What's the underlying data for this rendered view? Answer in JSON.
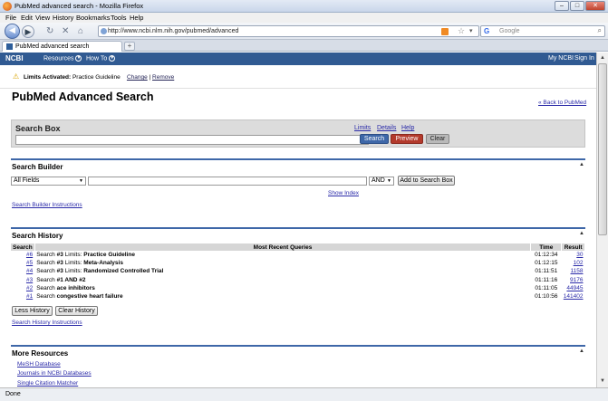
{
  "window": {
    "title": "PubMed advanced search - Mozilla Firefox"
  },
  "menu": [
    "File",
    "Edit",
    "View",
    "History",
    "Bookmarks",
    "Tools",
    "Help"
  ],
  "address": {
    "url": "http://www.ncbi.nlm.nih.gov/pubmed/advanced"
  },
  "search_engine": {
    "placeholder": "Google",
    "brand": "G"
  },
  "tab": {
    "label": "PubMed advanced search",
    "new_tab": "+"
  },
  "ncbi": {
    "logo": "NCBI",
    "resources": "Resources",
    "howto": "How To",
    "my_ncbi": "My NCBI",
    "sign_in": "Sign In"
  },
  "limits": {
    "label": "Limits Activated:",
    "value": "Practice Guideline",
    "change": "Change",
    "separator": "|",
    "remove": "Remove"
  },
  "page": {
    "title": "PubMed Advanced Search",
    "back_link": "« Back to PubMed"
  },
  "search_box": {
    "heading": "Search Box",
    "links": [
      "Limits",
      "Details",
      "Help"
    ],
    "search_button": "Search",
    "preview_button": "Preview",
    "clear_button": "Clear"
  },
  "builder": {
    "heading": "Search Builder",
    "field_select": "All Fields",
    "operator_select": "AND",
    "add_button": "Add to Search Box",
    "show_index": "Show Index",
    "instructions": "Search Builder Instructions"
  },
  "history": {
    "heading": "Search History",
    "columns": {
      "search": "Search",
      "query": "Most Recent Queries",
      "time": "Time",
      "result": "Result"
    },
    "rows": [
      {
        "id": "#6",
        "prefix": "Search ",
        "query": "#3",
        "mid": " Limits: ",
        "tail": "Practice Guideline",
        "time": "01:12:34",
        "result": "30"
      },
      {
        "id": "#5",
        "prefix": "Search ",
        "query": "#3",
        "mid": " Limits: ",
        "tail": "Meta-Analysis",
        "time": "01:12:15",
        "result": "102"
      },
      {
        "id": "#4",
        "prefix": "Search ",
        "query": "#3",
        "mid": " Limits: ",
        "tail": "Randomized Controlled Trial",
        "time": "01:11:51",
        "result": "1158"
      },
      {
        "id": "#3",
        "prefix": "Search ",
        "query": "#1 AND #2",
        "mid": "",
        "tail": "",
        "time": "01:11:16",
        "result": "9176"
      },
      {
        "id": "#2",
        "prefix": "Search ",
        "query": "ace inhibitors",
        "mid": "",
        "tail": "",
        "time": "01:11:05",
        "result": "44945"
      },
      {
        "id": "#1",
        "prefix": "Search ",
        "query": "congestive heart failure",
        "mid": "",
        "tail": "",
        "time": "01:10:56",
        "result": "141402"
      }
    ],
    "less_button": "Less History",
    "clear_button": "Clear History",
    "instructions": "Search History Instructions"
  },
  "resources": {
    "heading": "More Resources",
    "links": [
      "MeSH Database",
      "Journals in NCBI Databases",
      "Single Citation Matcher"
    ]
  },
  "status": {
    "text": "Done"
  }
}
